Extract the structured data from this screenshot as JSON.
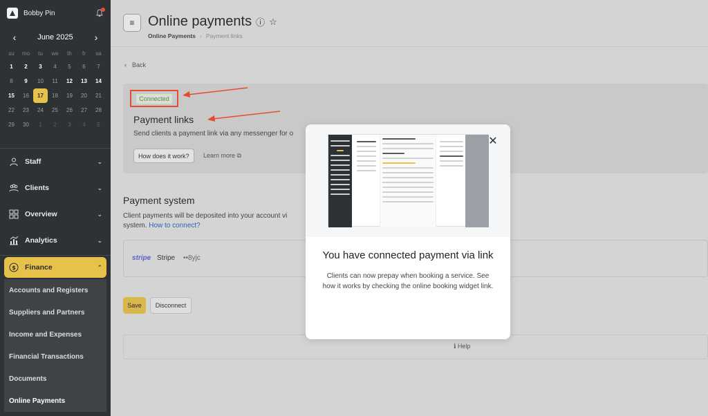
{
  "sidebar": {
    "user_name": "Bobby Pin",
    "calendar": {
      "month": "June 2025",
      "weekdays": [
        "su",
        "mo",
        "tu",
        "we",
        "th",
        "fr",
        "sa"
      ],
      "days": [
        {
          "t": "1",
          "s": "bold"
        },
        {
          "t": "2",
          "s": "bold"
        },
        {
          "t": "3",
          "s": "bold"
        },
        {
          "t": "4",
          "s": ""
        },
        {
          "t": "5",
          "s": ""
        },
        {
          "t": "6",
          "s": ""
        },
        {
          "t": "7",
          "s": ""
        },
        {
          "t": "8",
          "s": ""
        },
        {
          "t": "9",
          "s": "bold"
        },
        {
          "t": "10",
          "s": ""
        },
        {
          "t": "11",
          "s": ""
        },
        {
          "t": "12",
          "s": "bold"
        },
        {
          "t": "13",
          "s": "bold"
        },
        {
          "t": "14",
          "s": "bold"
        },
        {
          "t": "15",
          "s": "bold"
        },
        {
          "t": "16",
          "s": ""
        },
        {
          "t": "17",
          "s": "today"
        },
        {
          "t": "18",
          "s": ""
        },
        {
          "t": "19",
          "s": ""
        },
        {
          "t": "20",
          "s": ""
        },
        {
          "t": "21",
          "s": ""
        },
        {
          "t": "22",
          "s": ""
        },
        {
          "t": "23",
          "s": ""
        },
        {
          "t": "24",
          "s": ""
        },
        {
          "t": "25",
          "s": ""
        },
        {
          "t": "26",
          "s": ""
        },
        {
          "t": "27",
          "s": ""
        },
        {
          "t": "28",
          "s": ""
        },
        {
          "t": "29",
          "s": ""
        },
        {
          "t": "30",
          "s": ""
        },
        {
          "t": "1",
          "s": "muted"
        },
        {
          "t": "2",
          "s": "muted"
        },
        {
          "t": "3",
          "s": "muted"
        },
        {
          "t": "4",
          "s": "muted"
        },
        {
          "t": "5",
          "s": "muted"
        }
      ]
    },
    "menu": {
      "staff": "Staff",
      "clients": "Clients",
      "overview": "Overview",
      "analytics": "Analytics",
      "finance": "Finance"
    },
    "finance_items": [
      "Accounts and Registers",
      "Suppliers and Partners",
      "Income and Expenses",
      "Financial Transactions",
      "Documents",
      "Online Payments"
    ]
  },
  "header": {
    "title": "Online payments",
    "breadcrumb_1": "Online Payments",
    "breadcrumb_sep": "›",
    "breadcrumb_2": "Payment links"
  },
  "main": {
    "back": "Back",
    "status_badge": "Connected",
    "card_title": "Payment links",
    "card_subtitle": "Send clients a payment link via any messenger for o",
    "how_button": "How does it work?",
    "learn_more": "Learn more",
    "payment_title": "Payment system",
    "payment_desc": "Client payments will be deposited into your account vi",
    "payment_desc_2": "system.",
    "how_to_connect": "How to connect?",
    "stripe_logo": "stripe",
    "stripe_name": "Stripe",
    "stripe_key": "••8yjc",
    "save": "Save",
    "disconnect": "Disconnect",
    "help": "Help"
  },
  "modal": {
    "title": "You have connected payment via link",
    "text": "Clients can now prepay when booking a service. See how it works by checking the online booking widget link."
  },
  "colors": {
    "accent": "#e6c24a",
    "sidebar_bg": "#2f3235",
    "annotation": "#e54c2f",
    "link": "#2e63b6"
  }
}
